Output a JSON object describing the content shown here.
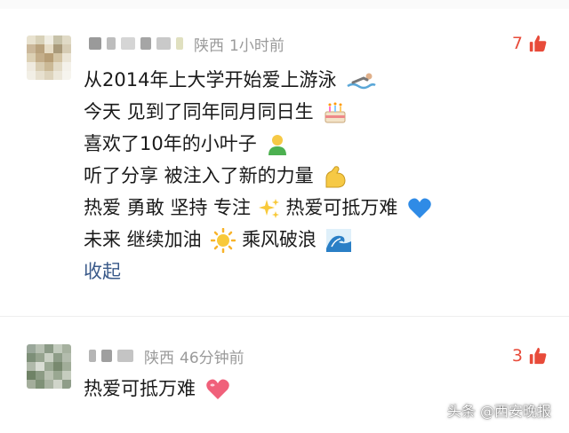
{
  "comments": [
    {
      "location": "陕西",
      "time": "1小时前",
      "likes": "7",
      "lines": [
        "从2014年上大学开始爱上游泳",
        "今天 见到了同年同月同日生",
        "喜欢了10年的小叶子",
        "听了分享 被注入了新的力量",
        "热爱 勇敢 坚持 专注",
        "未来 继续加油",
        "乘风破浪"
      ],
      "line5_suffix": "热爱可抵万难",
      "collapse_label": "收起",
      "emoji": [
        "swimmer-icon",
        "cake-icon",
        "person-green-icon",
        "flexed-biceps-icon",
        "sparkles-icon",
        "blue-heart-icon",
        "sun-icon",
        "wave-icon"
      ]
    },
    {
      "location": "陕西",
      "time": "46分钟前",
      "likes": "3",
      "lines": [
        "热爱可抵万难"
      ],
      "emoji": [
        "pink-heart-icon"
      ]
    }
  ],
  "watermark": "头条 @西安晚报",
  "colors": {
    "like": "#e84b3a",
    "collapse": "#3a5a8a",
    "meta": "#9a9a9a"
  }
}
